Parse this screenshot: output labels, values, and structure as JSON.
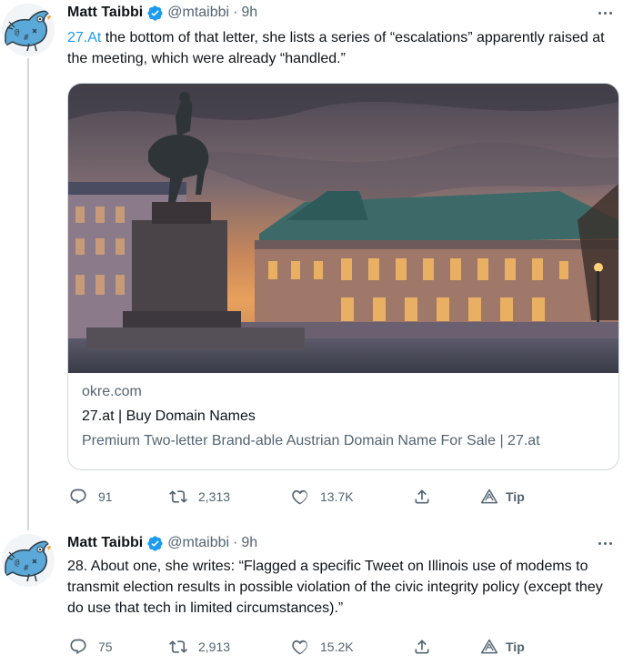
{
  "tweets": [
    {
      "author_name": "Matt Taibbi",
      "handle": "@mtaibbi",
      "separator": "·",
      "time": "9h",
      "text_link": "27.At",
      "text": " the bottom of that letter, she lists a series of “escalations” apparently raised at the meeting, which were already “handled.”",
      "card": {
        "domain": "okre.com",
        "title": "27.at | Buy Domain Names",
        "description": "Premium Two-letter Brand-able Austrian Domain Name For Sale | 27.at"
      },
      "replies": "91",
      "retweets": "2,313",
      "likes": "13.7K",
      "tip_label": "Tip"
    },
    {
      "author_name": "Matt Taibbi",
      "handle": "@mtaibbi",
      "separator": "·",
      "time": "9h",
      "text": "28. About one, she writes: “Flagged a specific Tweet on Illinois use of modems to transmit election results in possible violation of the civic integrity policy (except they do use that tech in limited circumstances).”",
      "replies": "75",
      "retweets": "2,913",
      "likes": "15.2K",
      "tip_label": "Tip"
    }
  ],
  "icons": [
    "avatar-bird-icon",
    "verified-badge-icon",
    "more-icon",
    "reply-icon",
    "retweet-icon",
    "like-icon",
    "share-icon",
    "tip-icon"
  ],
  "colors": {
    "accent": "#1d9bf0",
    "text": "#0f1419",
    "secondary": "#536471",
    "border": "#cfd9de",
    "avatar_bird": "#5aa9d8"
  }
}
